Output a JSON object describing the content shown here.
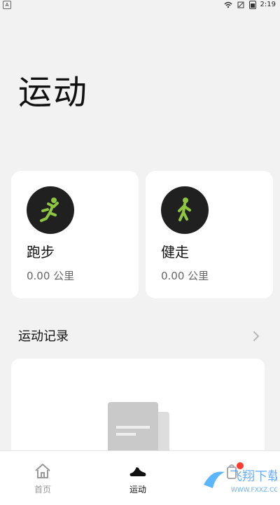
{
  "status_bar": {
    "left_icon": "A",
    "time": "2:19",
    "icons": [
      "wifi-icon",
      "sim-icon",
      "battery-icon"
    ]
  },
  "page": {
    "title": "运动"
  },
  "cards": [
    {
      "title": "跑步",
      "value": "0.00 公里",
      "icon": "running-icon",
      "accent_color": "#8ec63f"
    },
    {
      "title": "健走",
      "value": "0.00 公里",
      "icon": "walking-icon",
      "accent_color": "#8ec63f"
    }
  ],
  "records": {
    "title": "运动记录",
    "chevron_icon": "chevron-right-icon",
    "empty_icon": "document-icon"
  },
  "bottom_nav": [
    {
      "label": "首页",
      "icon": "home-icon",
      "active": false
    },
    {
      "label": "运动",
      "icon": "shoe-icon",
      "active": true
    },
    {
      "label": "",
      "icon": "shopping-bag-icon",
      "active": false,
      "badge": true
    }
  ],
  "watermark": {
    "text": "飞翔下载",
    "subtext": "WWW.FXXZ.COM"
  }
}
